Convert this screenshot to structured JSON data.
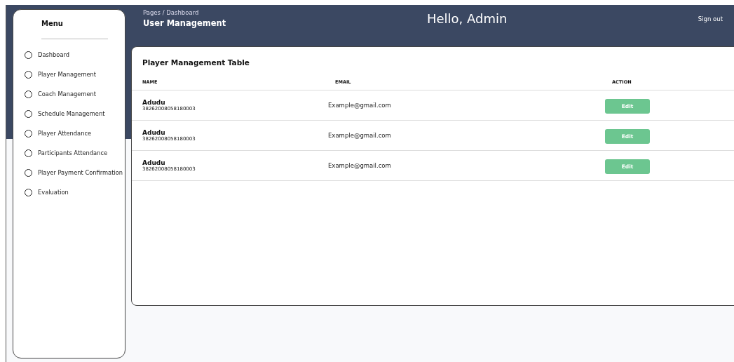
{
  "sidebar": {
    "title": "Menu",
    "items": [
      {
        "label": "Dashboard",
        "selected": false
      },
      {
        "label": "Player Management",
        "selected": false
      },
      {
        "label": "Coach Management",
        "selected": false
      },
      {
        "label": "Schedule Management",
        "selected": false
      },
      {
        "label": "Player Attendance",
        "selected": false
      },
      {
        "label": "Participants Attendance",
        "selected": false
      },
      {
        "label": "Player Payment Confirmation",
        "selected": false
      },
      {
        "label": "Evaluation",
        "selected": false
      }
    ]
  },
  "header": {
    "breadcrumb": "Pages / Dashboard",
    "page_title": "User Management",
    "greeting": "Hello, Admin",
    "sign_out": "Sign out"
  },
  "table": {
    "title": "Player Management Table",
    "columns": [
      "NAME",
      "EMAIL",
      "ACTION"
    ],
    "rows": [
      {
        "name": "Adudu",
        "id": "38262008058180003",
        "email": "Example@gmail.com",
        "action": "Edit"
      },
      {
        "name": "Adudu",
        "id": "38262008058180003",
        "email": "Example@gmail.com",
        "action": "Edit"
      },
      {
        "name": "Adudu",
        "id": "38262008058180003",
        "email": "Example@gmail.com",
        "action": "Edit"
      }
    ]
  }
}
